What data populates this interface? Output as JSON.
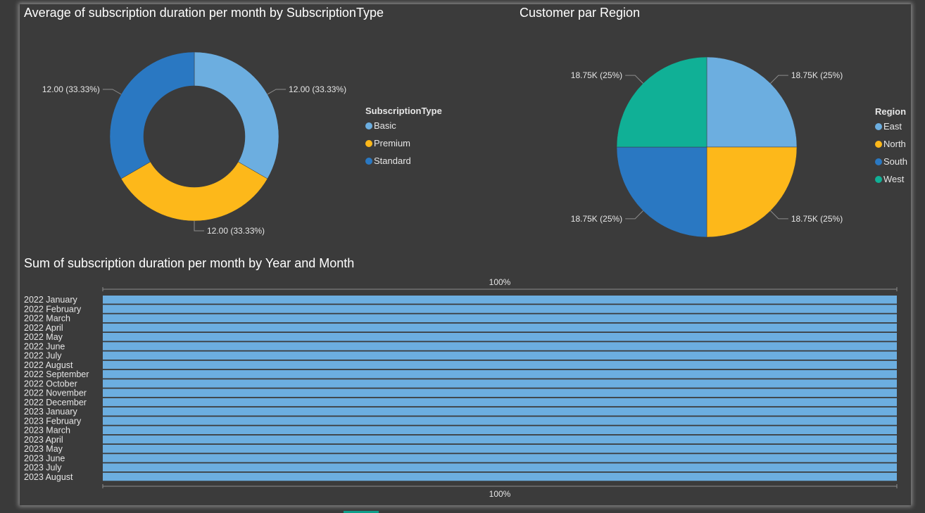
{
  "page": {
    "active_tab_color": "#0e9e8a"
  },
  "colors": {
    "light_blue": "#6caee0",
    "yellow": "#fdb81a",
    "dark_blue": "#2a78c2",
    "teal": "#10b096",
    "background": "#3b3b3b",
    "text": "#ffffff",
    "label_text": "#e6e6e6"
  },
  "chart_data": [
    {
      "type": "pie",
      "variant": "donut",
      "title": "Average of subscription duration per month by SubscriptionType",
      "legend_title": "SubscriptionType",
      "legend_position": "right",
      "categories": [
        "Basic",
        "Premium",
        "Standard"
      ],
      "values": [
        12.0,
        12.0,
        12.0
      ],
      "data_labels": [
        "12.00 (33.33%)",
        "12.00 (33.33%)",
        "12.00 (33.33%)"
      ],
      "colors": [
        "#6caee0",
        "#fdb81a",
        "#2a78c2"
      ]
    },
    {
      "type": "pie",
      "title": "Customer par Region",
      "legend_title": "Region",
      "legend_position": "right",
      "categories": [
        "East",
        "North",
        "South",
        "West"
      ],
      "values": [
        18750,
        18750,
        18750,
        18750
      ],
      "data_labels": [
        "18.75K (25%)",
        "18.75K (25%)",
        "18.75K (25%)",
        "18.75K (25%)"
      ],
      "colors": [
        "#6caee0",
        "#fdb81a",
        "#2a78c2",
        "#10b096"
      ]
    },
    {
      "type": "bar",
      "orientation": "horizontal",
      "stacking": "100%",
      "title": "Sum of subscription duration per month by Year and Month",
      "axis_label_top": "100%",
      "axis_label_bottom": "100%",
      "categories": [
        "2022 January",
        "2022 February",
        "2022 March",
        "2022 April",
        "2022 May",
        "2022 June",
        "2022 July",
        "2022 August",
        "2022 September",
        "2022 October",
        "2022 November",
        "2022 December",
        "2023 January",
        "2023 February",
        "2023 March",
        "2023 April",
        "2023 May",
        "2023 June",
        "2023 July",
        "2023 August"
      ],
      "values": [
        100,
        100,
        100,
        100,
        100,
        100,
        100,
        100,
        100,
        100,
        100,
        100,
        100,
        100,
        100,
        100,
        100,
        100,
        100,
        100
      ],
      "xlim": [
        0,
        100
      ],
      "color": "#6caee0"
    }
  ]
}
